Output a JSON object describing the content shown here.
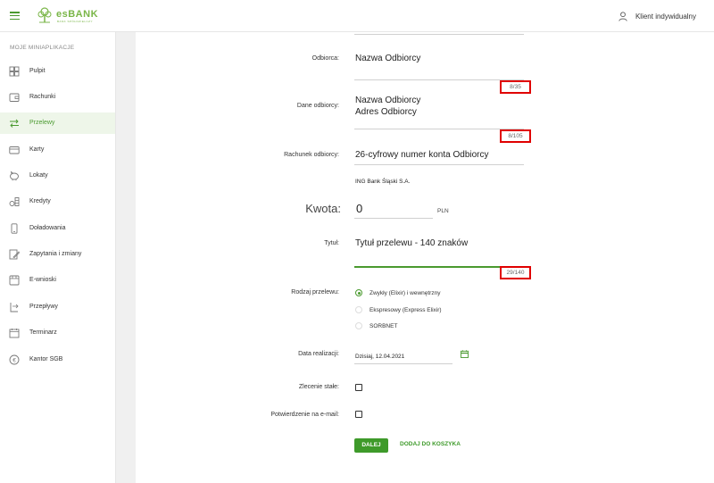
{
  "header": {
    "logo_text": "esBANK",
    "logo_sub": "BANK SPÓŁDZIELCZY",
    "client_label": "Klient indywidualny"
  },
  "sidebar": {
    "heading": "MOJE MINIAPLIKACJE",
    "items": [
      {
        "label": "Pulpit",
        "icon": "dashboard-icon",
        "active": false
      },
      {
        "label": "Rachunki",
        "icon": "wallet-icon",
        "active": false
      },
      {
        "label": "Przelewy",
        "icon": "transfer-arrows-icon",
        "active": true
      },
      {
        "label": "Karty",
        "icon": "card-icon",
        "active": false
      },
      {
        "label": "Lokaty",
        "icon": "piggy-bank-icon",
        "active": false
      },
      {
        "label": "Kredyty",
        "icon": "coins-icon",
        "active": false
      },
      {
        "label": "Doładowania",
        "icon": "phone-icon",
        "active": false
      },
      {
        "label": "Zapytania i zmiany",
        "icon": "edit-icon",
        "active": false
      },
      {
        "label": "E-wnioski",
        "icon": "inbox-icon",
        "active": false
      },
      {
        "label": "Przepływy",
        "icon": "flow-icon",
        "active": false
      },
      {
        "label": "Terminarz",
        "icon": "calendar-icon",
        "active": false
      },
      {
        "label": "Kantor SGB",
        "icon": "currency-exchange-icon",
        "active": false
      }
    ]
  },
  "form": {
    "odbiorca_label": "Odbiorca:",
    "odbiorca_value": "Nazwa Odbiorcy",
    "odbiorca_counter": "8/35",
    "dane_label": "Dane odbiorcy:",
    "dane_line1": "Nazwa Odbiorcy",
    "dane_line2": "Adres Odbiorcy",
    "dane_counter": "8/105",
    "rachunek_label": "Rachunek odbiorcy:",
    "rachunek_value": "26-cyfrowy numer konta Odbiorcy",
    "bank_name": "ING Bank Śląski S.A.",
    "kwota_label": "Kwota:",
    "kwota_value": "0",
    "currency": "PLN",
    "tytul_label": "Tytuł:",
    "tytul_value": "Tytuł przelewu - 140 znaków",
    "tytul_counter": "29/140",
    "rodzaj_label": "Rodzaj przelewu:",
    "rodzaj_options": [
      {
        "label": "Zwykły (Elixir) i wewnętrzny",
        "checked": true
      },
      {
        "label": "Ekspresowy (Express Elixir)",
        "checked": false
      },
      {
        "label": "SORBNET",
        "checked": false
      }
    ],
    "data_label": "Data realizacji:",
    "data_value": "Dzisiaj, 12.04.2021",
    "zlecenie_label": "Zlecenie stałe:",
    "potwierdzenie_label": "Potwierdzenie na e-mail:",
    "dalej_label": "DALEJ",
    "koszyk_label": "DODAJ DO KOSZYKA"
  },
  "colors": {
    "accent": "#4a9a2f",
    "highlight_border": "#e00000",
    "active_bg": "#eef6e9"
  }
}
